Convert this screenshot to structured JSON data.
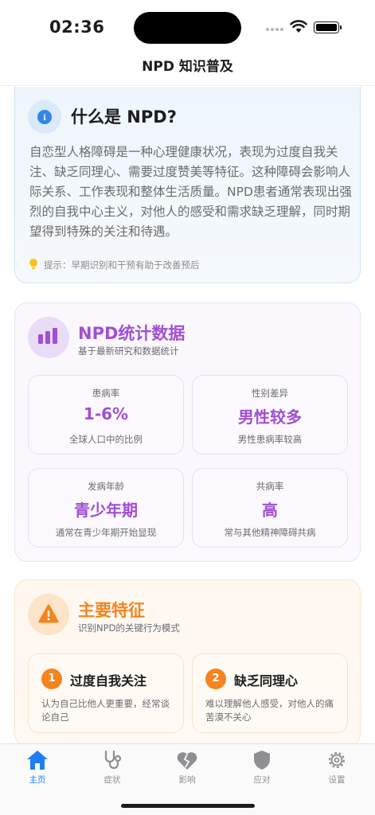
{
  "status_bar": {
    "time": "02:36"
  },
  "nav": {
    "title": "NPD 知识普及"
  },
  "what_is": {
    "title": "什么是 NPD?",
    "body": "自恋型人格障碍是一种心理健康状况，表现为过度自我关注、缺乏同理心、需要过度赞美等特征。这种障碍会影响人际关系、工作表现和整体生活质量。NPD患者通常表现出强烈的自我中心主义，对他人的感受和需求缺乏理解，同时期望得到特殊的关注和待遇。",
    "tip": "提示：早期识别和干预有助于改善预后",
    "icon": "info-icon",
    "accent": "#2f86e8"
  },
  "stats": {
    "title": "NPD统计数据",
    "subtitle": "基于最新研究和数据统计",
    "icon": "bar-chart-icon",
    "accent": "#a24fd2",
    "items": [
      {
        "label": "患病率",
        "value": "1-6%",
        "desc": "全球人口中的比例"
      },
      {
        "label": "性别差异",
        "value": "男性较多",
        "desc": "男性患病率较高"
      },
      {
        "label": "发病年龄",
        "value": "青少年期",
        "desc": "通常在青少年期开始显现"
      },
      {
        "label": "共病率",
        "value": "高",
        "desc": "常与其他精神障碍共病"
      }
    ]
  },
  "features": {
    "title": "主要特征",
    "subtitle": "识别NPD的关键行为模式",
    "icon": "warning-icon",
    "accent": "#f5841f",
    "items": [
      {
        "num": "1",
        "name": "过度自我关注",
        "desc": "认为自己比他人更重要，经常谈论自己"
      },
      {
        "num": "2",
        "name": "缺乏同理心",
        "desc": "难以理解他人感受，对他人的痛苦漠不关心"
      }
    ]
  },
  "tabbar": {
    "active_color": "#1e7ef5",
    "tabs": [
      {
        "label": "主页",
        "icon": "home-icon"
      },
      {
        "label": "症状",
        "icon": "stethoscope-icon"
      },
      {
        "label": "影响",
        "icon": "broken-heart-icon"
      },
      {
        "label": "应对",
        "icon": "shield-icon"
      },
      {
        "label": "设置",
        "icon": "gear-icon"
      }
    ]
  }
}
